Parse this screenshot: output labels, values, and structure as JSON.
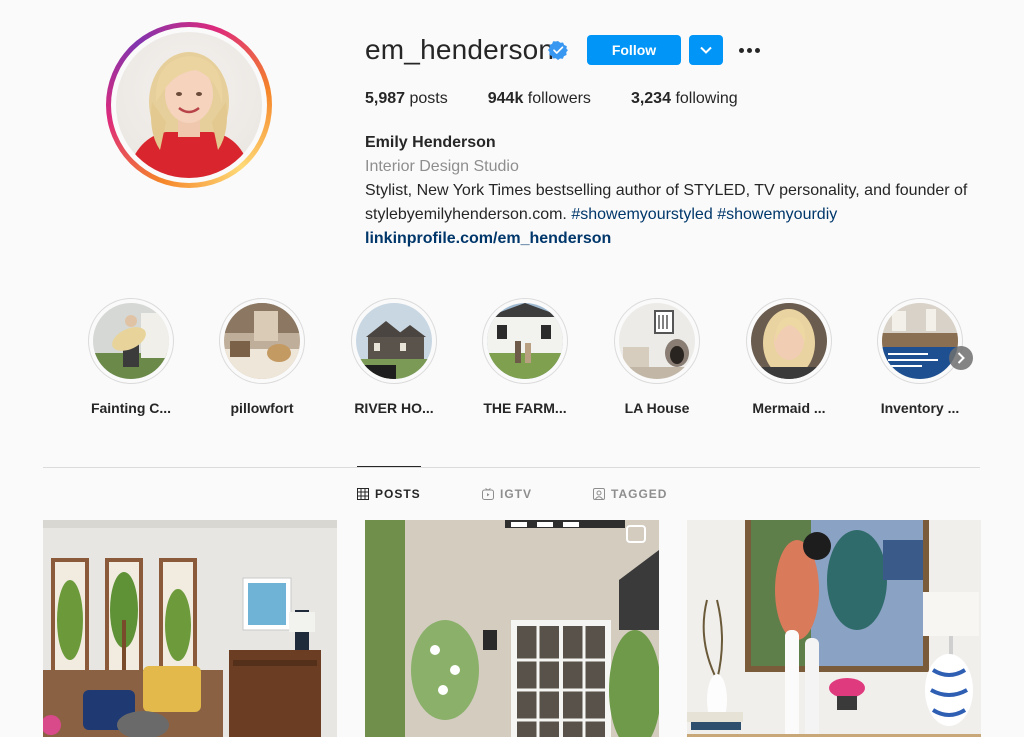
{
  "profile": {
    "username": "em_henderson",
    "verified": true,
    "follow_label": "Follow",
    "stats": [
      {
        "value": "5,987",
        "label": "posts"
      },
      {
        "value": "944k",
        "label": "followers"
      },
      {
        "value": "3,234",
        "label": "following"
      }
    ],
    "name": "Emily Henderson",
    "category": "Interior Design Studio",
    "bio_text": "Stylist, New York Times bestselling author of STYLED, TV personality, and founder of stylebyemilyhenderson.com.",
    "hashtags": [
      "#showemyourstyled",
      "#showemyourdiy"
    ],
    "link": "linkinprofile.com/em_henderson"
  },
  "highlights": [
    {
      "label": "Fainting C..."
    },
    {
      "label": "pillowfort"
    },
    {
      "label": "RIVER HO..."
    },
    {
      "label": "THE FARM..."
    },
    {
      "label": "LA House"
    },
    {
      "label": "Mermaid ..."
    },
    {
      "label": "Inventory ..."
    }
  ],
  "tabs": [
    {
      "label": "POSTS",
      "icon": "grid-icon",
      "active": true
    },
    {
      "label": "IGTV",
      "icon": "igtv-icon",
      "active": false
    },
    {
      "label": "TAGGED",
      "icon": "tagged-icon",
      "active": false
    }
  ],
  "colors": {
    "accent": "#0095f6",
    "link": "#00376b",
    "secondary_text": "#8e8e8e"
  }
}
